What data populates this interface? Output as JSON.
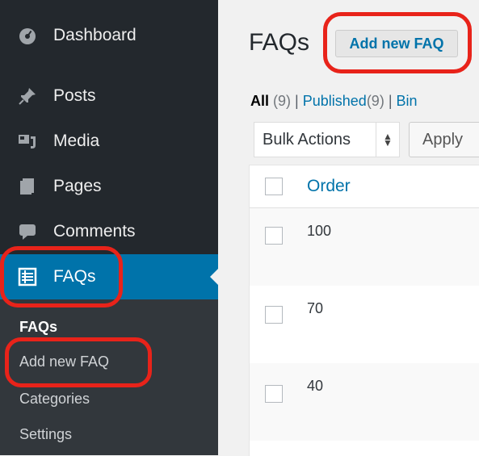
{
  "sidebar": {
    "items": [
      {
        "label": "Dashboard",
        "icon": "dashboard-icon"
      },
      {
        "label": "Posts",
        "icon": "pin-icon"
      },
      {
        "label": "Media",
        "icon": "media-icon"
      },
      {
        "label": "Pages",
        "icon": "pages-icon"
      },
      {
        "label": "Comments",
        "icon": "comment-icon"
      },
      {
        "label": "FAQs",
        "icon": "list-icon"
      }
    ],
    "submenu": [
      "FAQs",
      "Add new FAQ",
      "Categories",
      "Settings"
    ]
  },
  "main": {
    "title": "FAQs",
    "add_new_label": "Add new FAQ",
    "filters": {
      "all": "All",
      "all_count": "(9)",
      "sep1": "|",
      "published": "Published",
      "published_count": "(9)",
      "sep2": "|",
      "bin": "Bin"
    },
    "bulk_actions_label": "Bulk Actions",
    "apply_label": "Apply",
    "table": {
      "header": "Order",
      "rows": [
        "100",
        "70",
        "40"
      ]
    }
  },
  "colors": {
    "sidebar_bg": "#23282d",
    "active_bg": "#0073aa",
    "highlight": "#e8231a",
    "link": "#0073aa"
  }
}
